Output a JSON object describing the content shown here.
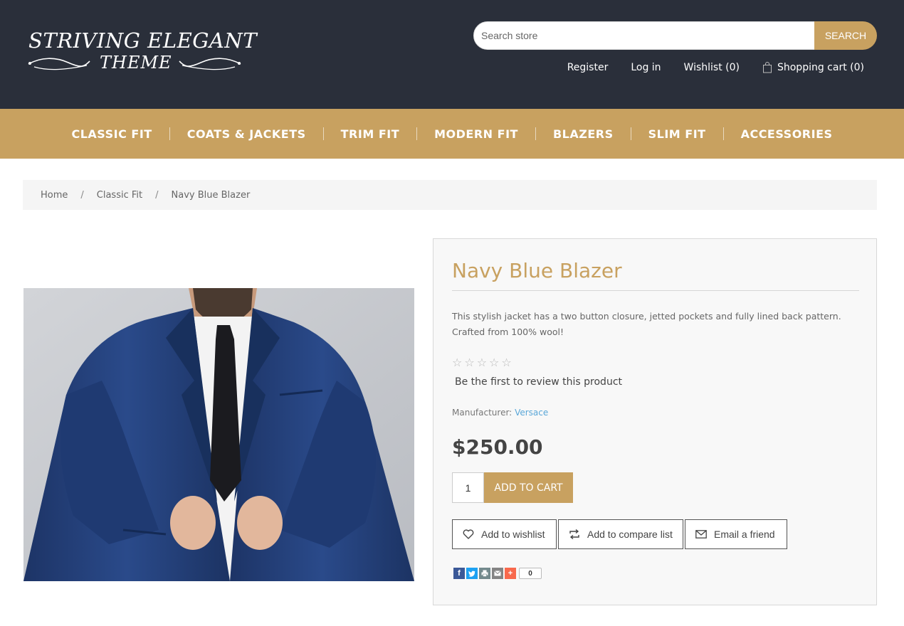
{
  "header": {
    "logo_line1": "STRIVING ELEGANT",
    "logo_line2": "THEME",
    "search_placeholder": "Search store",
    "search_button": "SEARCH",
    "links": {
      "register": "Register",
      "login": "Log in",
      "wishlist": "Wishlist (0)",
      "cart": "Shopping cart (0)"
    }
  },
  "nav": {
    "items": [
      "CLASSIC FIT",
      "COATS & JACKETS",
      "TRIM FIT",
      "MODERN FIT",
      "BLAZERS",
      "SLIM FIT",
      "ACCESSORIES"
    ]
  },
  "breadcrumb": {
    "items": [
      "Home",
      "Classic Fit",
      "Navy Blue Blazer"
    ],
    "separator": "/"
  },
  "product": {
    "title": "Navy Blue Blazer",
    "description": "This stylish jacket has a two button closure, jetted pockets and fully lined back pattern. Crafted from 100% wool!",
    "rating_stars": 0,
    "rating_max": 5,
    "review_link": "Be the first to review this product",
    "manufacturer_label": "Manufacturer:",
    "manufacturer_value": "Versace",
    "price": "$250.00",
    "quantity": "1",
    "add_to_cart": "ADD TO CART",
    "actions": {
      "wishlist": "Add to wishlist",
      "compare": "Add to compare list",
      "email": "Email a friend"
    },
    "share_count": "0"
  },
  "colors": {
    "header_bg": "#2a2f3a",
    "accent_gold": "#c8a160",
    "link_blue": "#5aa7d8",
    "panel_bg": "#f8f8f8"
  }
}
